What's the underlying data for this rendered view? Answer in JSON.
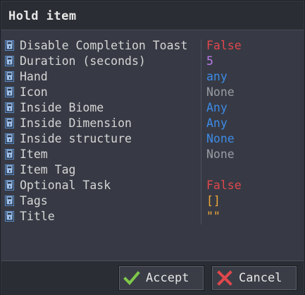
{
  "window": {
    "title": "Hold item"
  },
  "properties": [
    {
      "label": "Disable Completion Toast",
      "value": "False",
      "color": "#e0474c"
    },
    {
      "label": "Duration (seconds)",
      "value": "5",
      "color": "#b97be8"
    },
    {
      "label": "Hand",
      "value": "any",
      "color": "#3d8be8"
    },
    {
      "label": "Icon",
      "value": "None",
      "color": "#9a9ca3"
    },
    {
      "label": "Inside Biome",
      "value": "Any",
      "color": "#3d8be8"
    },
    {
      "label": "Inside Dimension",
      "value": "Any",
      "color": "#3d8be8"
    },
    {
      "label": "Inside structure",
      "value": "None",
      "color": "#3d8be8"
    },
    {
      "label": "Item",
      "value": "None",
      "color": "#9a9ca3"
    },
    {
      "label": "Item Tag",
      "value": "",
      "color": "#9a9ca3"
    },
    {
      "label": "Optional Task",
      "value": "False",
      "color": "#e0474c"
    },
    {
      "label": "Tags",
      "value": "[]",
      "color": "#f0a93a"
    },
    {
      "label": "Title",
      "value": "\"\"",
      "color": "#f0a93a"
    }
  ],
  "buttons": {
    "accept_label": "Accept",
    "cancel_label": "Cancel",
    "accept_icon": "checkmark-icon",
    "cancel_icon": "x-icon",
    "accept_icon_color": "#7ec84a",
    "cancel_icon_color": "#e0474c"
  },
  "icons": {
    "row_icon": "lock-icon",
    "lock_color": "#5e8ec8"
  }
}
